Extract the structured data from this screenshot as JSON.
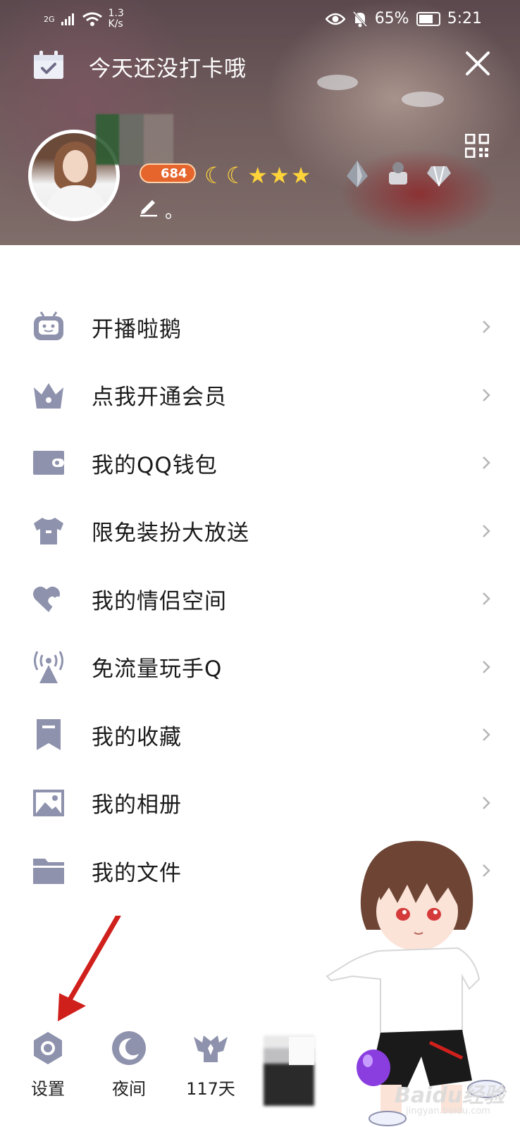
{
  "status_bar": {
    "network_type": "2G",
    "speed_value": "1.3",
    "speed_unit": "K/s",
    "battery_percent": "65%",
    "time": "5:21"
  },
  "header": {
    "checkin_text": "今天还没打卡哦",
    "level_number": "684",
    "signature_text": "。"
  },
  "menu": {
    "items": [
      {
        "label": "开播啦鹅",
        "icon": "tv-robot-icon"
      },
      {
        "label": "点我开通会员",
        "icon": "crown-icon"
      },
      {
        "label": "我的QQ钱包",
        "icon": "wallet-icon"
      },
      {
        "label": "限免装扮大放送",
        "icon": "tshirt-icon"
      },
      {
        "label": "我的情侣空间",
        "icon": "hearts-icon"
      },
      {
        "label": "免流量玩手Q",
        "icon": "signal-tower-icon"
      },
      {
        "label": "我的收藏",
        "icon": "bookmark-icon"
      },
      {
        "label": "我的相册",
        "icon": "image-icon"
      },
      {
        "label": "我的文件",
        "icon": "folder-icon"
      }
    ]
  },
  "bottom_bar": {
    "settings_label": "设置",
    "night_label": "夜间",
    "days_label": "117天"
  },
  "watermark": {
    "text": "Baidu经验",
    "sub": "jingyan.baidu.com"
  },
  "colors": {
    "icon_gray": "#8e92ad",
    "arrow_red": "#d0201c",
    "level_orange": "#e5652d"
  }
}
